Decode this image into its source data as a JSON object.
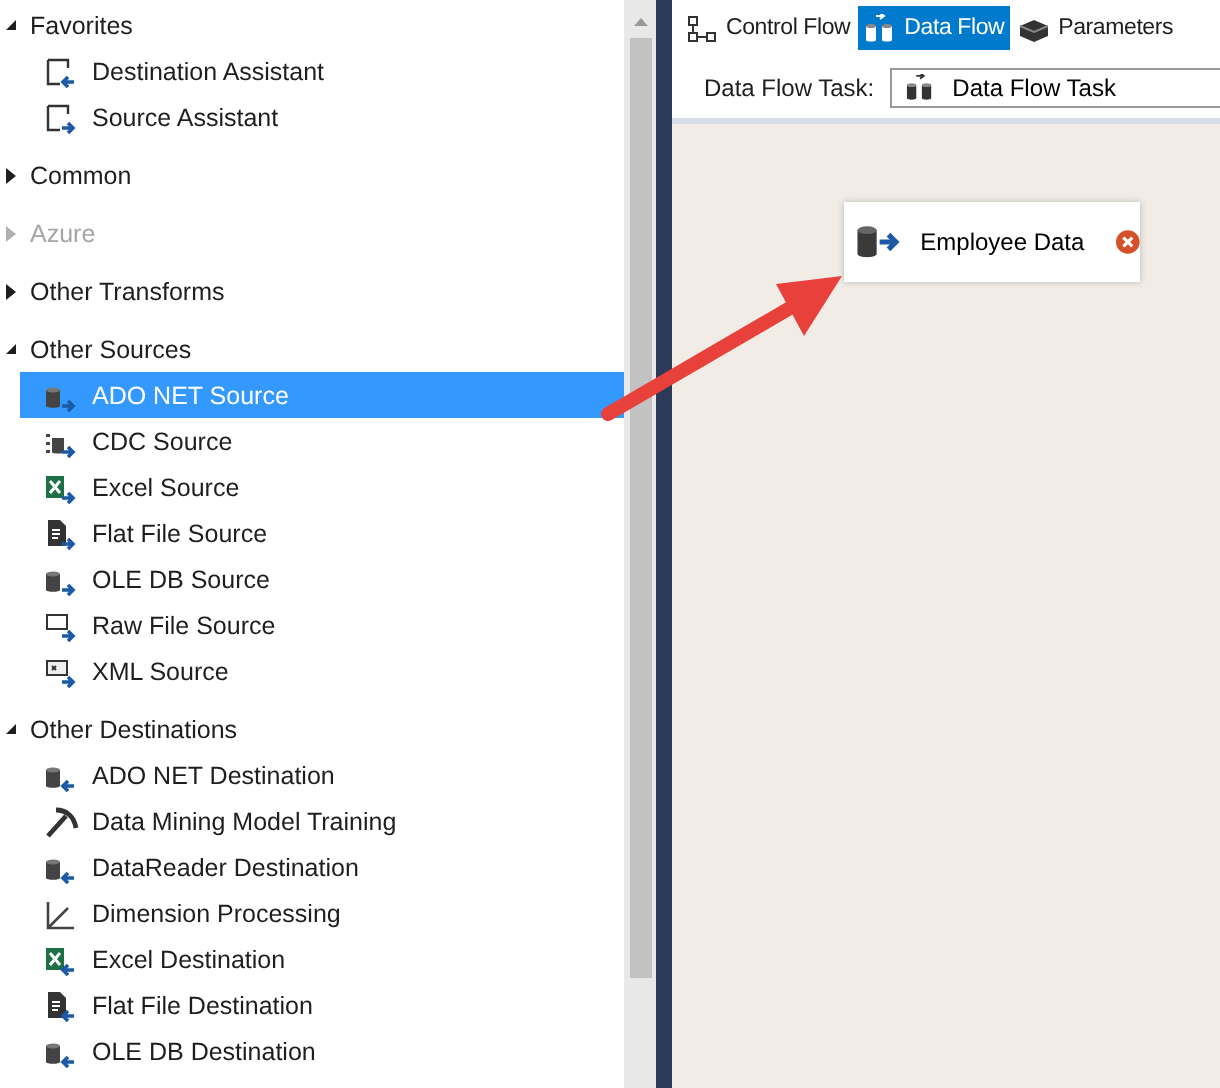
{
  "toolbox": {
    "groups": [
      {
        "label": "Favorites",
        "expanded": true,
        "disabled": false,
        "items": [
          {
            "label": "Destination Assistant",
            "selected": false
          },
          {
            "label": "Source Assistant",
            "selected": false
          }
        ]
      },
      {
        "label": "Common",
        "expanded": false,
        "disabled": false
      },
      {
        "label": "Azure",
        "expanded": false,
        "disabled": true
      },
      {
        "label": "Other Transforms",
        "expanded": false,
        "disabled": false
      },
      {
        "label": "Other Sources",
        "expanded": true,
        "disabled": false,
        "items": [
          {
            "label": "ADO NET Source",
            "selected": true
          },
          {
            "label": "CDC Source",
            "selected": false
          },
          {
            "label": "Excel Source",
            "selected": false
          },
          {
            "label": "Flat File Source",
            "selected": false
          },
          {
            "label": "OLE DB Source",
            "selected": false
          },
          {
            "label": "Raw File Source",
            "selected": false
          },
          {
            "label": "XML Source",
            "selected": false
          }
        ]
      },
      {
        "label": "Other Destinations",
        "expanded": true,
        "disabled": false,
        "items": [
          {
            "label": "ADO NET Destination",
            "selected": false
          },
          {
            "label": "Data Mining Model Training",
            "selected": false
          },
          {
            "label": "DataReader Destination",
            "selected": false
          },
          {
            "label": "Dimension Processing",
            "selected": false
          },
          {
            "label": "Excel Destination",
            "selected": false
          },
          {
            "label": "Flat File Destination",
            "selected": false
          },
          {
            "label": "OLE DB Destination",
            "selected": false
          }
        ]
      }
    ]
  },
  "designer": {
    "tabs": [
      {
        "label": "Control Flow",
        "selected": false
      },
      {
        "label": "Data Flow",
        "selected": true
      },
      {
        "label": "Parameters",
        "selected": false
      }
    ],
    "task_label": "Data Flow Task:",
    "task_value": "Data Flow Task",
    "canvas": {
      "components": [
        {
          "label": "Employee Data",
          "error": true
        }
      ]
    }
  }
}
